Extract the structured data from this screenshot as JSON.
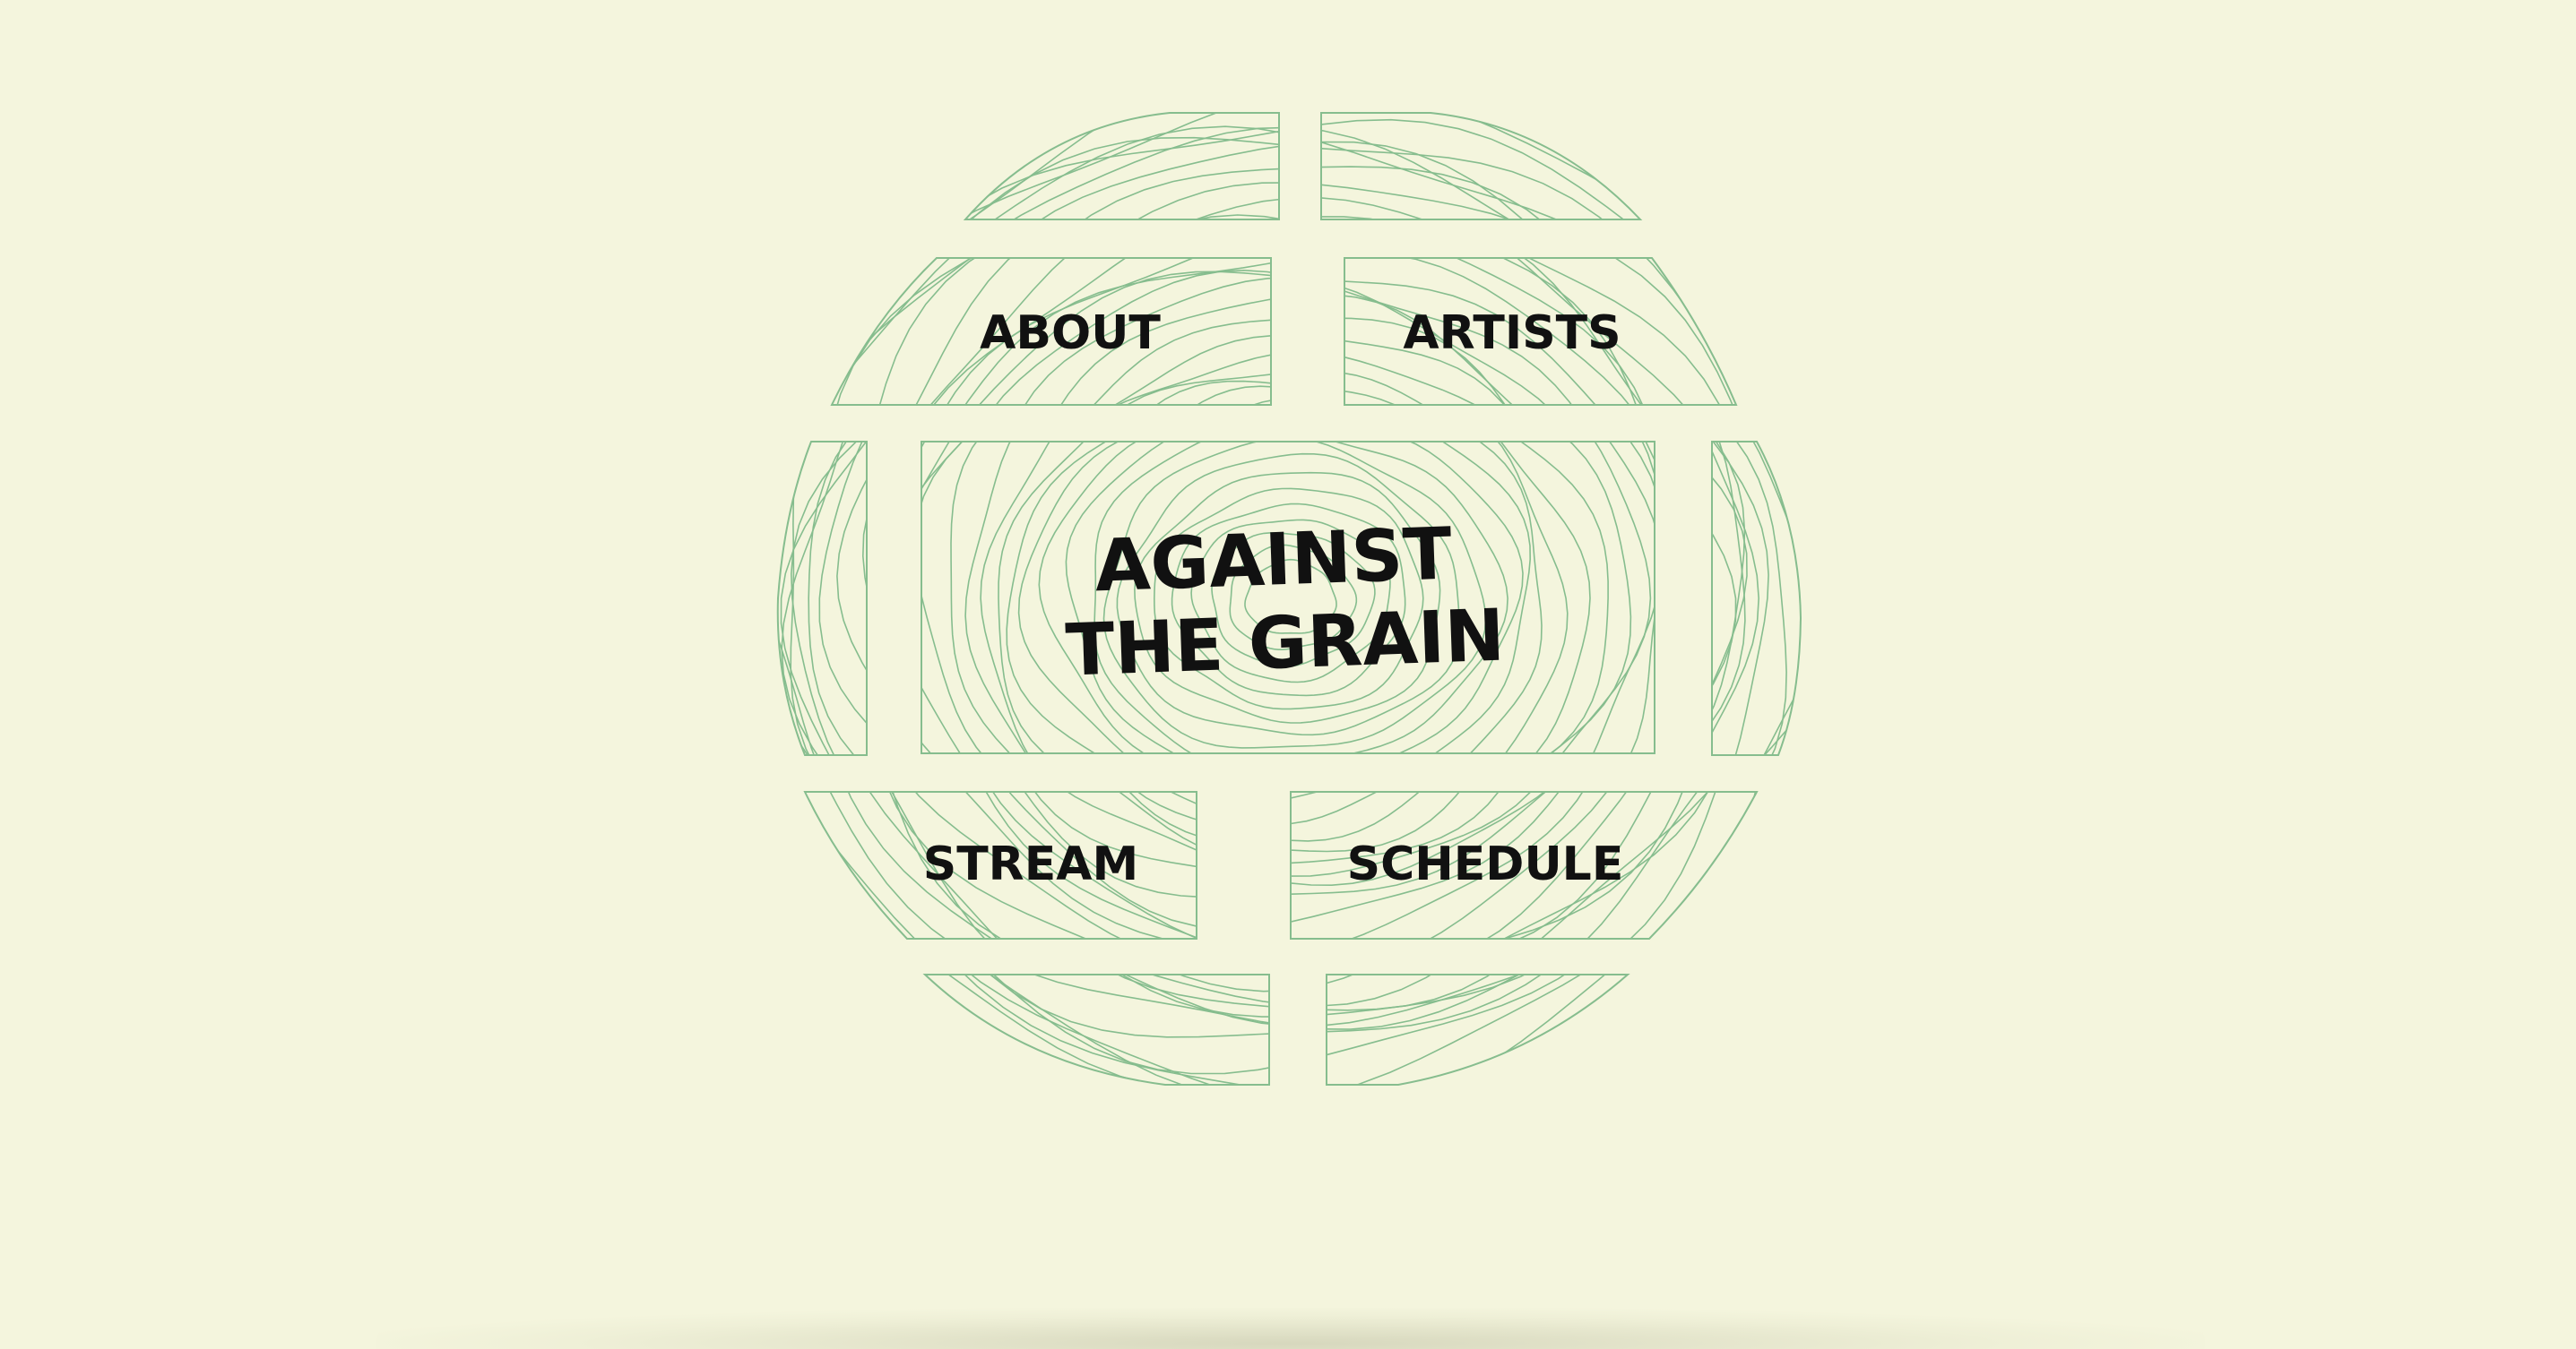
{
  "site": {
    "title_line1": "AGAINST",
    "title_line2": "THE GRAIN"
  },
  "nav": {
    "about": "ABOUT",
    "artists": "ARTISTS",
    "stream": "STREAM",
    "schedule": "SCHEDULE"
  },
  "colors": {
    "background": "#f4f5dd",
    "grain_line": "#86bd8e",
    "text": "#111111"
  }
}
